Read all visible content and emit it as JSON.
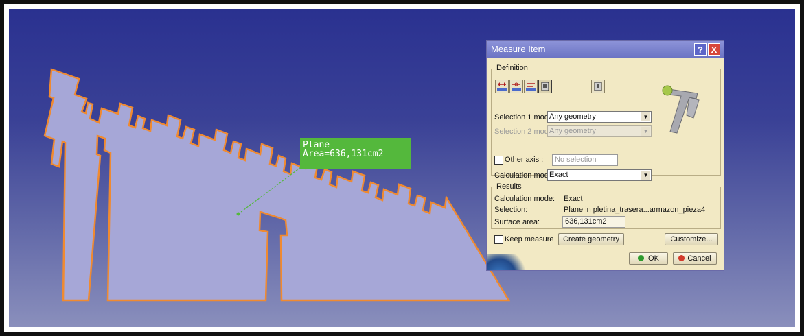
{
  "annotation": {
    "line1": "Plane",
    "line2": "Area=636,131cm2"
  },
  "dialog": {
    "title": "Measure Item",
    "help_label": "?",
    "close_label": "X",
    "definition": {
      "label": "Definition",
      "icons": [
        "measure-between-icon",
        "measure-between-chain-icon",
        "measure-between-fan-icon",
        "measure-item-icon",
        "measure-thickness-icon"
      ],
      "selection1_label": "Selection 1 mode:",
      "selection1_value": "Any geometry",
      "selection2_label": "Selection 2 mode:",
      "selection2_value": "Any geometry",
      "other_axis_label": "Other axis :",
      "other_axis_value": "No selection",
      "calc_mode_label": "Calculation mode:",
      "calc_mode_value": "Exact"
    },
    "results": {
      "label": "Results",
      "calc_mode_label": "Calculation mode:",
      "calc_mode_value": "Exact",
      "selection_label": "Selection:",
      "selection_value": "Plane in pletina_trasera...armazon_pieza4",
      "surface_area_label": "Surface area:",
      "surface_area_value": "636,131cm2"
    },
    "keep_measure_label": "Keep measure",
    "create_geometry_label": "Create geometry",
    "customize_label": "Customize...",
    "ok_label": "OK",
    "cancel_label": "Cancel"
  },
  "colors": {
    "viewport_top": "#2a3190",
    "viewport_bottom": "#8a8fbc",
    "part_fill": "#a6a7d7",
    "part_edge": "#f08a30",
    "annotation_bg": "#54b83c",
    "dialog_bg": "#f2e9c4",
    "titlebar": "#7c84d0"
  }
}
